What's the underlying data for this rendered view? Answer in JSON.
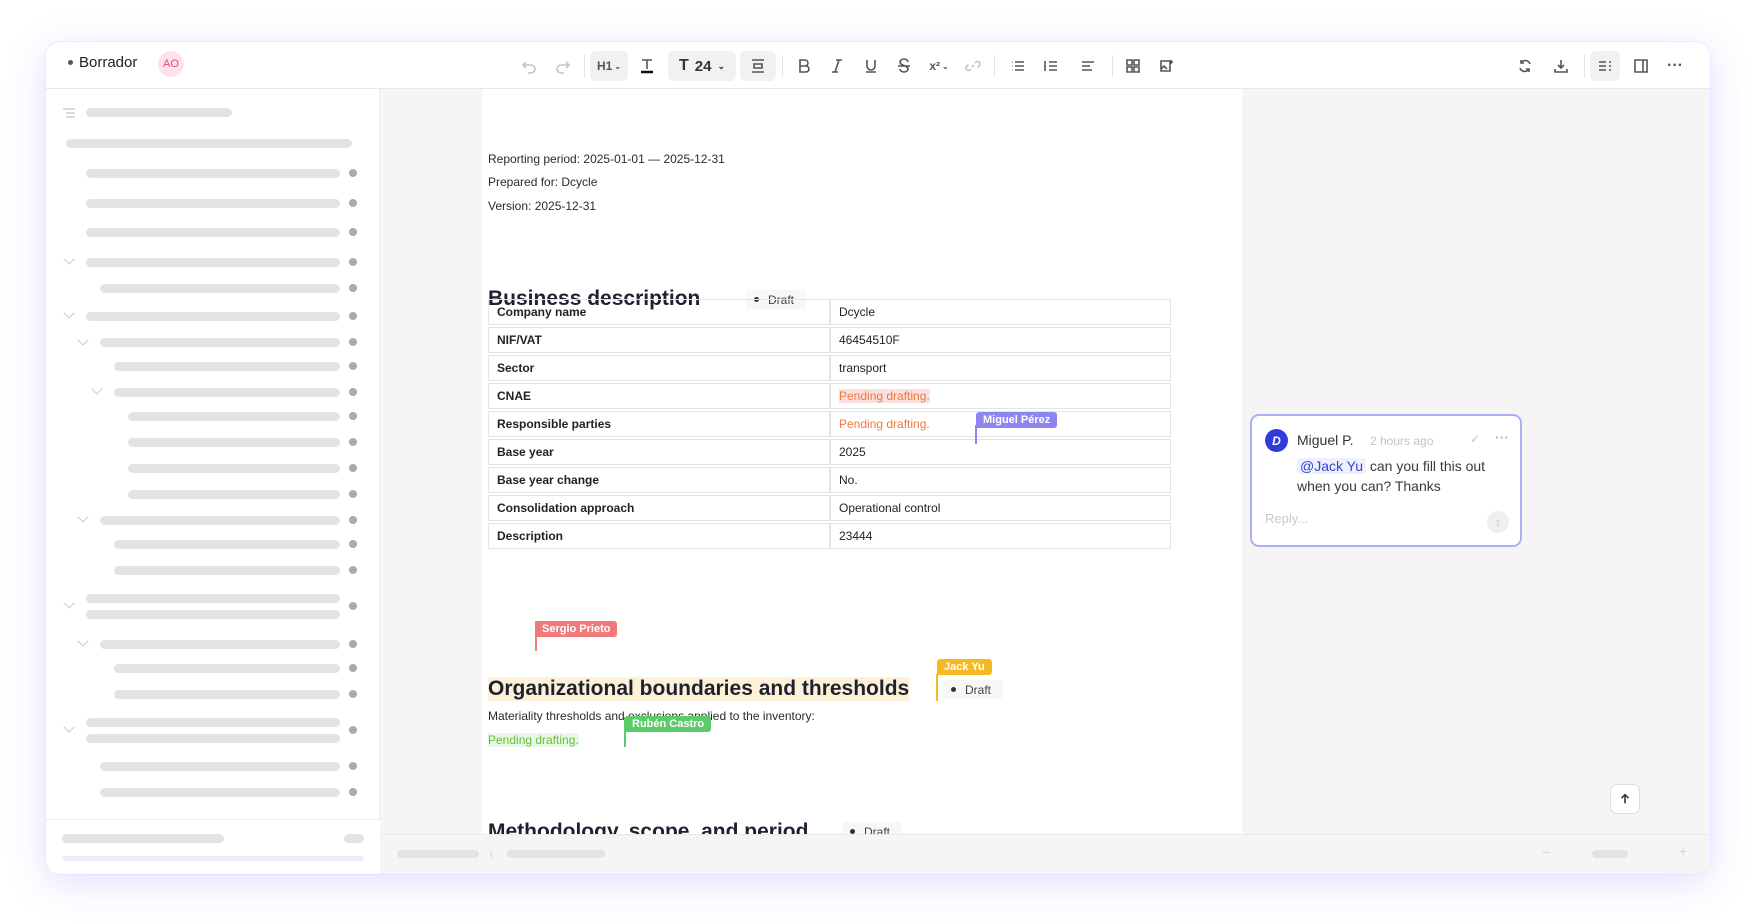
{
  "header": {
    "status_label": "Borrador",
    "avatar_initials": "AO",
    "heading_select": "H1",
    "font_size": "24"
  },
  "document": {
    "meta": [
      "Reporting period: 2025-01-01 — 2025-12-31",
      "Prepared for: Dcycle",
      "Version: 2025-12-31"
    ],
    "sections": [
      {
        "title": "Business description",
        "badge": "Draft"
      },
      {
        "title": "Organizational boundaries and thresholds",
        "badge": "Draft"
      },
      {
        "title": "Methodology, scope, and period",
        "badge": "Draft"
      }
    ],
    "table": [
      {
        "key": "Company name",
        "value": "Dcycle"
      },
      {
        "key": "NIF/VAT",
        "value": "46454510F"
      },
      {
        "key": "Sector",
        "value": "transport"
      },
      {
        "key": "CNAE",
        "value": "Pending drafting."
      },
      {
        "key": "Responsible parties",
        "value": "Pending drafting."
      },
      {
        "key": "Base year",
        "value": "2025"
      },
      {
        "key": "Base year change",
        "value": "No."
      },
      {
        "key": "Consolidation approach",
        "value": "Operational control"
      },
      {
        "key": "Description",
        "value": "23444"
      }
    ],
    "boundaries_text": "Materiality thresholds and exclusions applied to the inventory:",
    "boundaries_pending": "Pending drafting."
  },
  "collaborators": {
    "miguel": {
      "name": "Miguel Pérez",
      "color": "#8b86f0"
    },
    "sergio": {
      "name": "Sergio Prieto",
      "color": "#f07a7a"
    },
    "jack": {
      "name": "Jack Yu",
      "color": "#f5b921"
    },
    "ruben": {
      "name": "Rubén Castro",
      "color": "#5ccb6a"
    }
  },
  "comment": {
    "author": "Miguel P.",
    "time": "2 hours ago",
    "mention": "@Jack Yu",
    "text": " can you fill this out when you can? Thanks",
    "reply_placeholder": "Reply..."
  },
  "icons": [
    "undo-icon",
    "redo-icon",
    "text-color-icon",
    "font-size-icon",
    "spacing-icon",
    "bold-icon",
    "italic-icon",
    "underline-icon",
    "strikethrough-icon",
    "superscript-icon",
    "link-icon",
    "bullet-list-icon",
    "indent-icon",
    "align-icon",
    "grid-icon",
    "image-icon",
    "refresh-icon",
    "download-icon",
    "outline-icon",
    "panel-icon",
    "more-icon"
  ]
}
